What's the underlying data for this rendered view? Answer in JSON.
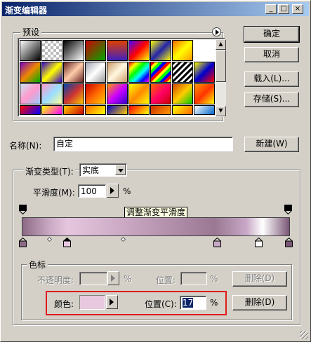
{
  "window": {
    "title": "渐变编辑器"
  },
  "presets": {
    "label": "预设"
  },
  "buttons": {
    "ok": "确定",
    "cancel": "取消",
    "load": "载入(L)...",
    "save": "存储(S)...",
    "new": "新建(W)"
  },
  "name": {
    "label": "名称(N):",
    "value": "自定"
  },
  "gradient": {
    "type_label": "渐变类型(T):",
    "type_value": "实底",
    "smoothness_label": "平滑度(M):",
    "smoothness_value": "100",
    "smoothness_unit": "%",
    "tooltip": "调整渐变平滑度"
  },
  "stops": {
    "group_label": "色标",
    "opacity_label": "不透明度:",
    "opacity_unit": "%",
    "opacity_location_label": "位置:",
    "opacity_location_unit": "%",
    "opacity_delete": "删除(D)",
    "color_label": "颜色:",
    "color_location_label": "位置(C):",
    "color_location_value": "17",
    "color_location_unit": "%",
    "color_delete": "删除(D)",
    "current_color": "#e8c8de"
  },
  "colors": {
    "title_start": "#0a246a",
    "title_end": "#a6caf0",
    "highlight_box": "#e01a1a"
  }
}
